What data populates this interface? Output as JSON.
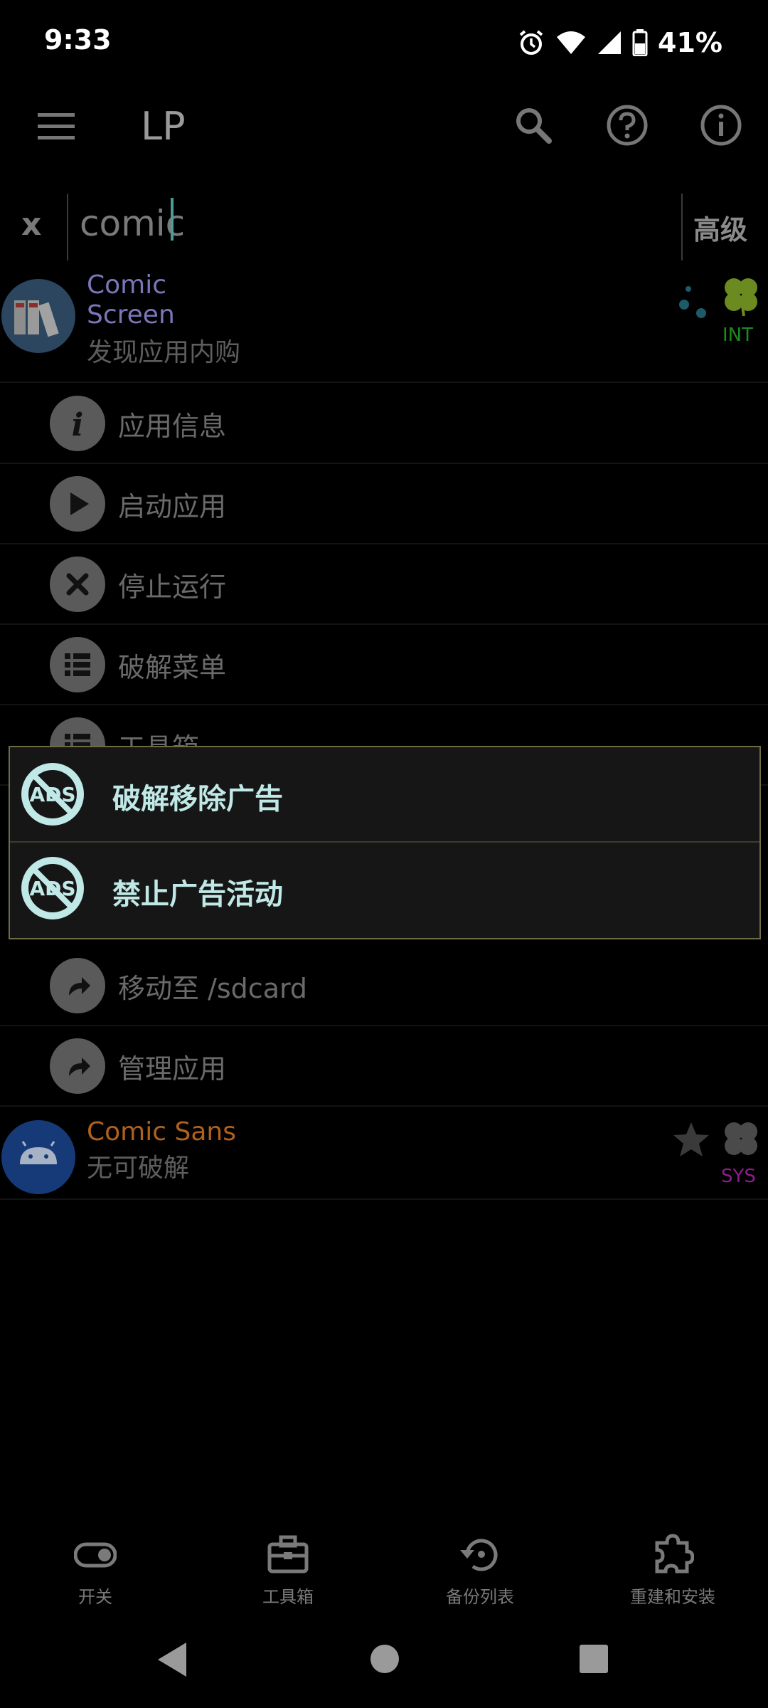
{
  "status_bar": {
    "time": "9:33",
    "battery": "41%",
    "icons": [
      "alarm-icon",
      "wifi-icon",
      "signal-icon",
      "battery-icon"
    ]
  },
  "app_bar": {
    "title": "LP",
    "icons": [
      "menu-icon",
      "search-icon",
      "help-icon",
      "info-icon"
    ]
  },
  "search": {
    "clear_label": "x",
    "value": "comic",
    "advanced_label": "高级"
  },
  "apps": [
    {
      "name_line1": "Comic",
      "name_line2": "Screen",
      "subtitle": "发现应用内购",
      "badge": "INT",
      "name_color": "#7a76b8",
      "badge_color": "#1e8a1e"
    },
    {
      "name": "Comic Sans",
      "subtitle": "无可破解",
      "badge": "SYS",
      "name_color": "#b0611c",
      "badge_color": "#8e1d8e"
    }
  ],
  "menu": {
    "items": [
      {
        "label": "应用信息",
        "icon": "info-icon"
      },
      {
        "label": "启动应用",
        "icon": "play-icon"
      },
      {
        "label": "停止运行",
        "icon": "close-icon"
      },
      {
        "label": "破解菜单",
        "icon": "list-icon"
      },
      {
        "label": "工具箱",
        "icon": "list-icon"
      },
      {
        "label": "移动至 /sdcard",
        "icon": "share-arrow-icon"
      },
      {
        "label": "管理应用",
        "icon": "share-arrow-icon"
      }
    ]
  },
  "popup": {
    "items": [
      {
        "label": "破解移除广告",
        "icon": "no-ads-icon"
      },
      {
        "label": "禁止广告活动",
        "icon": "no-ads-icon"
      }
    ]
  },
  "bottom_nav": {
    "items": [
      {
        "label": "开关",
        "icon": "toggle-icon"
      },
      {
        "label": "工具箱",
        "icon": "toolbox-icon"
      },
      {
        "label": "备份列表",
        "icon": "backup-restore-icon"
      },
      {
        "label": "重建和安装",
        "icon": "puzzle-icon"
      }
    ]
  },
  "colors": {
    "accent": "#bfe8e6",
    "popup_border": "#6f6c45"
  }
}
